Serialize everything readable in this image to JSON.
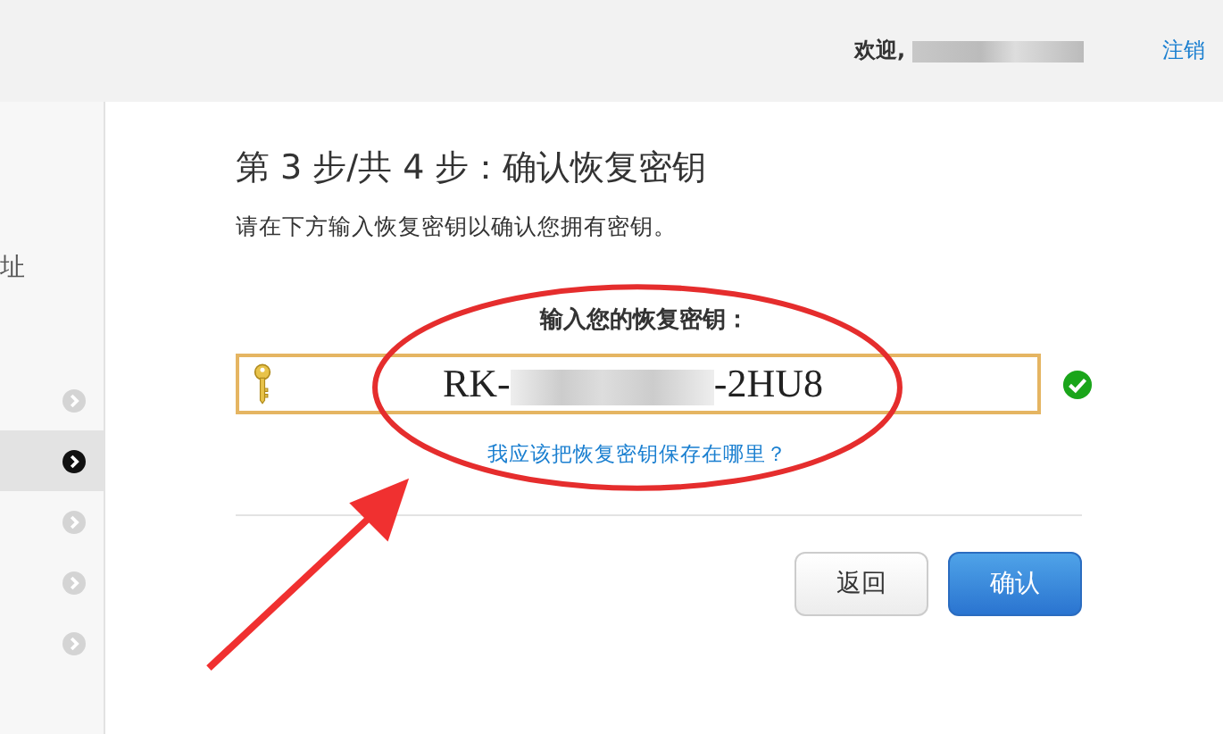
{
  "header": {
    "welcome": "欢迎,",
    "logout": "注销"
  },
  "sidebar": {
    "partial_label": "址",
    "items": [
      {
        "selected": false
      },
      {
        "selected": true
      },
      {
        "selected": false
      },
      {
        "selected": false
      },
      {
        "selected": false
      }
    ]
  },
  "step_title": "第 3 步/共 4 步：确认恢复密钥",
  "description": "请在下方输入恢复密钥以确认您拥有密钥。",
  "key_field": {
    "label": "输入您的恢复密钥：",
    "value_start": "RK-",
    "value_end": "-2HU8",
    "valid": true
  },
  "help_link": "我应该把恢复密钥保存在哪里？",
  "buttons": [
    {
      "label": "返回",
      "kind": "secondary"
    },
    {
      "label": "确认",
      "kind": "primary"
    }
  ]
}
